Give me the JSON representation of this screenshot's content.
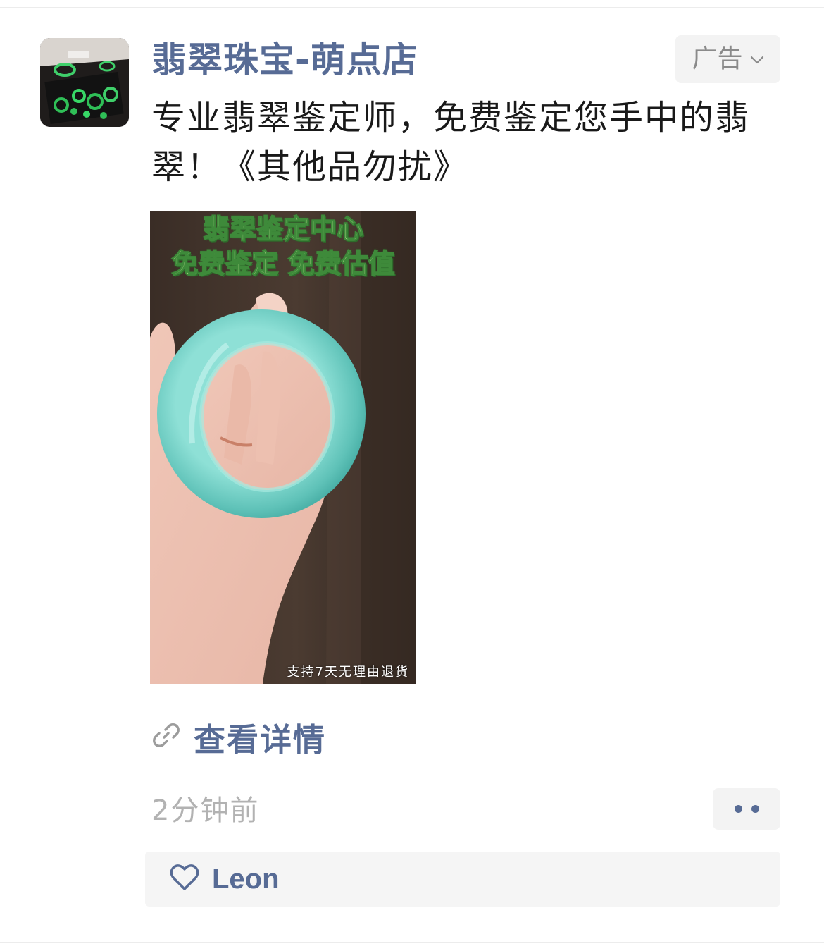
{
  "post": {
    "account_name": "翡翠珠宝-萌点店",
    "ad_label": "广告",
    "text": "专业翡翠鉴定师，免费鉴定您手中的翡翠！《其他品勿扰》",
    "media": {
      "headline_line1": "翡翠鉴定中心",
      "headline_line2": "免费鉴定 免费估值",
      "caption": "支持7天无理由退货"
    },
    "detail_link_label": "查看详情",
    "timestamp": "2分钟前",
    "likes": [
      "Leon"
    ]
  },
  "icons": {
    "ad_menu": "chevron-down-icon",
    "link": "link-icon",
    "more": "more-dots-icon",
    "like": "heart-outline-icon"
  },
  "colors": {
    "link_blue": "#576b95",
    "body_text": "#191919",
    "muted_text": "#b2b2b2",
    "panel_bg": "#f5f5f5"
  }
}
